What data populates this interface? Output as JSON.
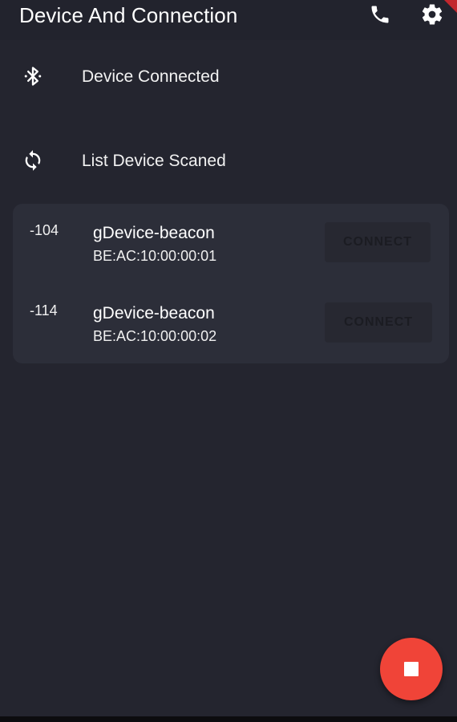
{
  "appbar": {
    "title": "Device And Connection",
    "icons": [
      "phone-icon",
      "gear-icon"
    ]
  },
  "menu": {
    "items": [
      {
        "label": "Device Connected",
        "icon": "bluetooth-icon"
      },
      {
        "label": "List Device Scaned",
        "icon": "refresh-icon"
      }
    ]
  },
  "devices": [
    {
      "rssi": "-104",
      "name": "gDevice-beacon",
      "mac": "BE:AC:10:00:00:01",
      "action": "CONNECT"
    },
    {
      "rssi": "-114",
      "name": "gDevice-beacon",
      "mac": "BE:AC:10:00:00:02",
      "action": "CONNECT"
    }
  ],
  "fab": {
    "icon": "stop-icon"
  },
  "colors": {
    "background": "#24252f",
    "card": "#2c2e39",
    "fab": "#f04438",
    "text": "#ffffff"
  }
}
